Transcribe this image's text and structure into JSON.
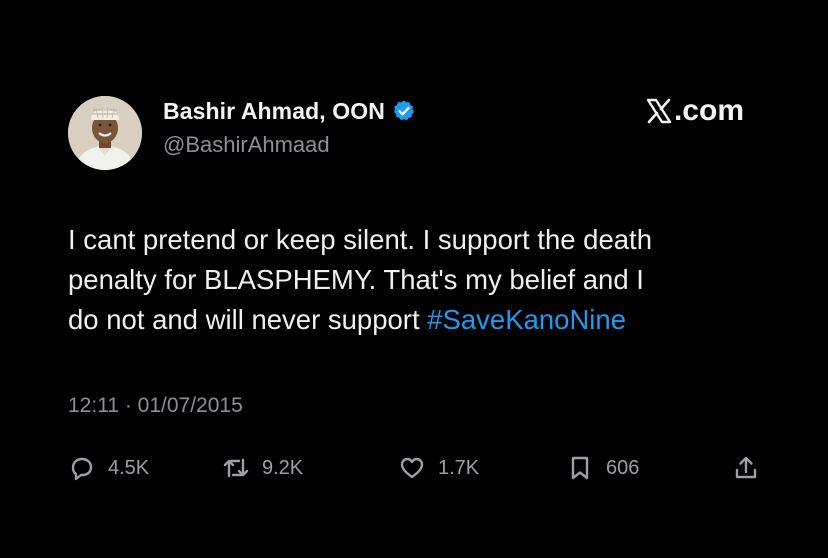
{
  "author": {
    "display_name": "Bashir Ahmad, OON",
    "handle": "@BashirAhmaad",
    "verified": true
  },
  "brand": {
    "label": ".com",
    "icon": "x-logo-icon"
  },
  "tweet": {
    "lines": [
      "I cant pretend or keep silent. I support the death",
      "penalty for BLASPHEMY. That's my belief and I",
      "do not and will never support "
    ],
    "hashtag": "#SaveKanoNine",
    "timestamp": "12:11 · 01/07/2015"
  },
  "actions": {
    "replies": "4.5K",
    "retweets": "9.2K",
    "likes": "1.7K",
    "bookmarks": "606"
  },
  "colors": {
    "background": "#000000",
    "hashtag": "#1d9bf0",
    "verified_badge": "#1d9bf0",
    "muted_text": "#8b9096"
  }
}
